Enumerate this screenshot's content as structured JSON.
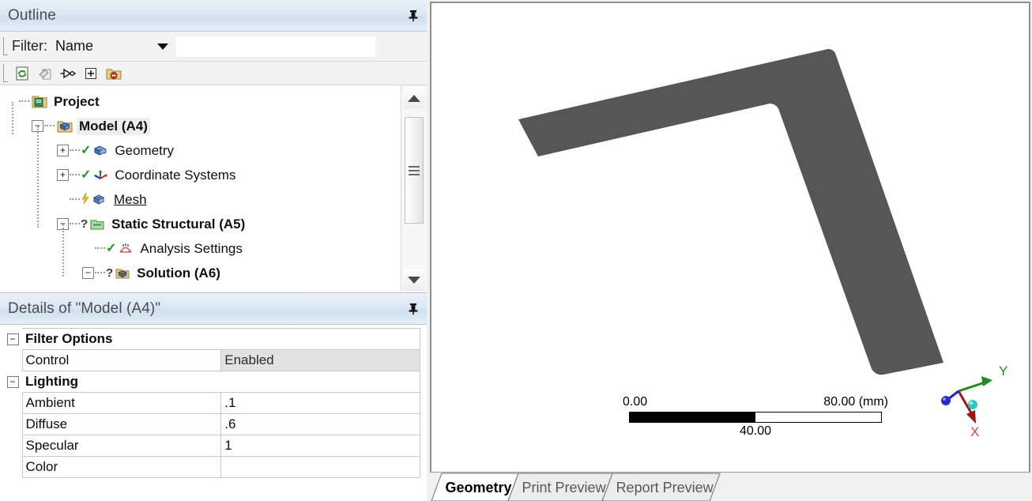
{
  "outline_panel": {
    "title": "Outline",
    "pin_icon": "pin-icon",
    "filter": {
      "label": "Filter:",
      "selected": "Name",
      "input_value": "",
      "input_placeholder": ""
    },
    "toolbar": [
      {
        "name": "refresh-tree-button",
        "icon": "refresh-page-icon"
      },
      {
        "name": "clear-filter-button",
        "icon": "eraser-icon"
      },
      {
        "name": "probe-filter-button",
        "icon": "probe-icon"
      },
      {
        "name": "expand-all-button",
        "icon": "plus-box-icon"
      },
      {
        "name": "collapse-folder-button",
        "icon": "folder-minus-icon"
      }
    ],
    "tree": [
      {
        "label": "Project",
        "level": 0,
        "bold": true,
        "icon": "project-book-icon",
        "expander": "",
        "status": "",
        "selected": false,
        "underline": false
      },
      {
        "label": "Model (A4)",
        "level": 1,
        "bold": true,
        "icon": "model-cube-icon",
        "expander": "-",
        "status": "",
        "selected": true,
        "underline": false
      },
      {
        "label": "Geometry",
        "level": 2,
        "bold": false,
        "icon": "geometry-blocks-icon",
        "expander": "+",
        "status": "check",
        "selected": false,
        "underline": false
      },
      {
        "label": "Coordinate Systems",
        "level": 2,
        "bold": false,
        "icon": "coordinate-systems-icon",
        "expander": "+",
        "status": "check",
        "selected": false,
        "underline": false
      },
      {
        "label": "Mesh",
        "level": 2,
        "bold": false,
        "icon": "mesh-cube-icon",
        "expander": "",
        "status": "bolt",
        "selected": false,
        "underline": true
      },
      {
        "label": "Static Structural (A5)",
        "level": 2,
        "bold": true,
        "icon": "analysis-folder-icon",
        "expander": "-",
        "status": "question",
        "selected": false,
        "underline": false
      },
      {
        "label": "Analysis Settings",
        "level": 3,
        "bold": false,
        "icon": "analysis-settings-icon",
        "expander": "",
        "status": "check",
        "selected": false,
        "underline": false
      },
      {
        "label": "Solution (A6)",
        "level": 3,
        "bold": true,
        "icon": "solution-cube-icon",
        "expander": "-",
        "status": "question",
        "selected": false,
        "underline": false
      }
    ],
    "scrollbar": {
      "up_arrow": "scroll-up-arrow",
      "down_arrow": "scroll-down-arrow"
    }
  },
  "details_panel": {
    "title": "Details of \"Model (A4)\"",
    "pin_icon": "pin-icon",
    "rows": [
      {
        "type": "header",
        "expander": "-",
        "label": "Filter Options"
      },
      {
        "type": "prop",
        "key": "Control",
        "value": "Enabled",
        "value_style": "gray"
      },
      {
        "type": "header",
        "expander": "-",
        "label": "Lighting"
      },
      {
        "type": "prop",
        "key": "Ambient",
        "value": ".1",
        "value_style": "white"
      },
      {
        "type": "prop",
        "key": "Diffuse",
        "value": ".6",
        "value_style": "white"
      },
      {
        "type": "prop",
        "key": "Specular",
        "value": "1",
        "value_style": "white"
      },
      {
        "type": "prop",
        "key": "Color",
        "value": "",
        "value_style": "white"
      }
    ]
  },
  "viewport": {
    "background": "#ffffff",
    "geometry": {
      "name": "l-shaped-bracket",
      "fill_color": "#565656"
    },
    "scale_legend": {
      "min": "0.00",
      "mid": "40.00",
      "max": "80.00 (mm)"
    },
    "triad": {
      "x_label": "X",
      "y_label": "Y",
      "x_color": "#cc2222",
      "y_color": "#1f8a1f",
      "z_color": "#2222cc",
      "origin_color": "#2ec7c7"
    },
    "tabs": [
      {
        "label": "Geometry",
        "active": true
      },
      {
        "label": "Print Preview",
        "active": false
      },
      {
        "label": "Report Preview",
        "active": false
      }
    ]
  }
}
